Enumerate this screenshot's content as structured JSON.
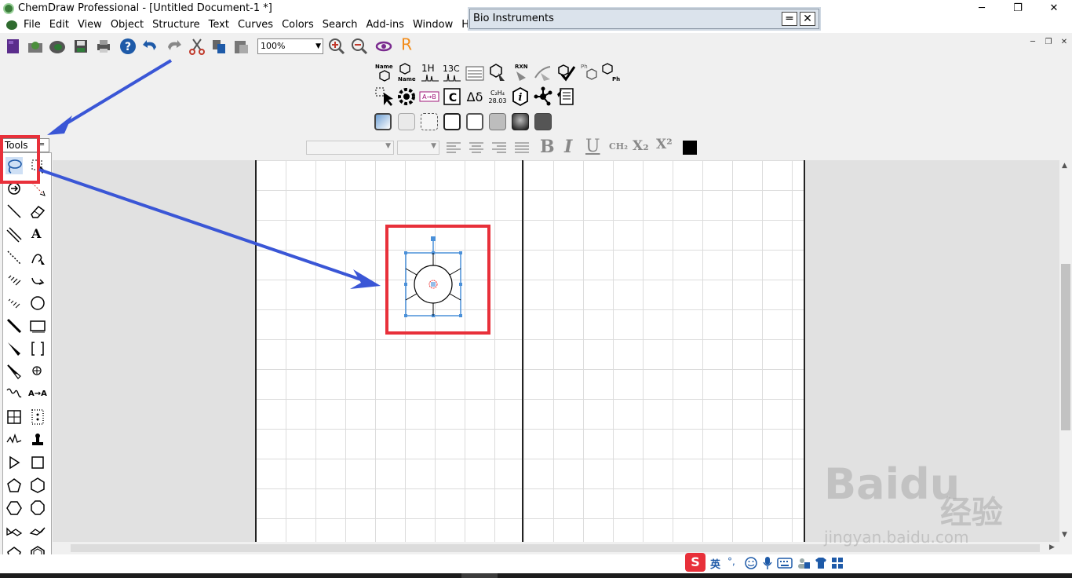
{
  "window": {
    "title": "ChemDraw Professional - [Untitled Document-1 *]",
    "minimize": "─",
    "restore": "❐",
    "close": "✕"
  },
  "menu": {
    "items": [
      "File",
      "Edit",
      "View",
      "Object",
      "Structure",
      "Text",
      "Curves",
      "Colors",
      "Search",
      "Add-ins",
      "Window",
      "Help"
    ],
    "mdi_minimize": "─",
    "mdi_restore": "❐",
    "mdi_close": "✕"
  },
  "bio_window": {
    "title": "Bio Instruments",
    "menu_glyph": "═",
    "close_glyph": "✕"
  },
  "toolbar": {
    "zoom_value": "100%"
  },
  "chem_toolbar": {
    "row1": [
      "Name→Struct",
      "Struct→Name",
      "¹H",
      "¹³C",
      "A→B",
      "Clean",
      "RXN",
      "Check",
      "Valid",
      "Ph",
      "Ph"
    ],
    "labels": {
      "name_top": "Name",
      "name_bottom": "Name",
      "h_nmr": "1H",
      "c_nmr": "13C",
      "rxn": "RXN",
      "ph1": "Ph",
      "ph2": "Ph",
      "ab": "A→B",
      "c_label": "C",
      "delta": "Δδ",
      "formula_top": "C₂H₄",
      "formula_bottom": "28.03",
      "info": "i"
    }
  },
  "format_toolbar": {
    "bold": "B",
    "italic": "I",
    "underline": "U",
    "ch2": "CH₂",
    "subscript": "X₂",
    "superscript": "X²"
  },
  "tools_palette": {
    "title": "Tools",
    "menu_glyph": "═",
    "text_tool": "A",
    "a_to_a": "A→A"
  },
  "ime": {
    "logo": "S",
    "lang": "英",
    "punct": "°,"
  },
  "watermark": {
    "brand": "Baidu",
    "cn": "经验",
    "url": "jingyan.baidu.com"
  },
  "colors": {
    "annotation_red": "#e8303a",
    "arrow_blue": "#3a56d6",
    "selection_blue": "#4a90d9"
  }
}
